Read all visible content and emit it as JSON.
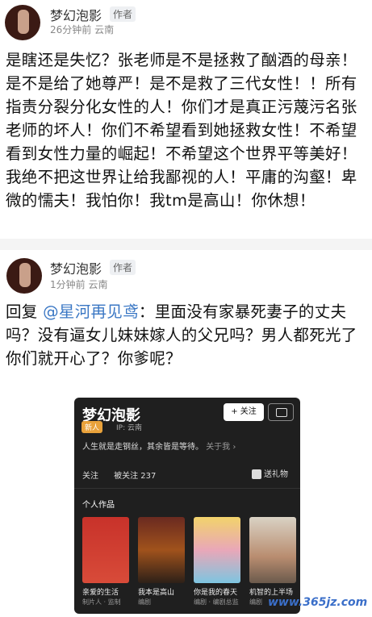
{
  "post1": {
    "username": "梦幻泡影",
    "role_tag": "作者",
    "time": "26分钟前",
    "location": "云南",
    "text": "是瞎还是失忆？张老师是不是拯救了酗酒的母亲！是不是给了她尊严！是不是救了三代女性！！所有指责分裂分化女性的人！你们才是真正污蔑污名张老师的坏人！你们不希望看到她拯救女性！不希望看到女性力量的崛起！不希望这个世界平等美好！我绝不把这世界让给我鄙视的人！平庸的沟壑！卑微的懦夫！我怕你！我tm是高山！你休想！"
  },
  "post2": {
    "username": "梦幻泡影",
    "role_tag": "作者",
    "time": "1分钟前",
    "location": "云南",
    "reply_prefix": "回复",
    "reply_target": "@星河再见鸢",
    "text": "：里面没有家暴死妻子的丈夫吗？没有逼女儿妹妹嫁人的父兄吗？男人都死光了你们就开心了？你爹呢？"
  },
  "profile_card": {
    "name": "梦幻泡影",
    "badge": "新人",
    "ip": "IP: 云南",
    "follow_label": "+ 关注",
    "bio": "人生就是走钢丝，其余皆是等待。",
    "bio_more": "关于我 ›",
    "following_label": "关注",
    "followers_label": "被关注",
    "followers_count": "237",
    "gift_label": "送礼物",
    "works_title": "个人作品",
    "works": [
      {
        "title": "亲爱的生活",
        "role": "制片人 · 监制"
      },
      {
        "title": "我本是高山",
        "role": "编剧"
      },
      {
        "title": "你是我的春天",
        "role": "编剧 · 编剧总监"
      },
      {
        "title": "机智的上半场",
        "role": "编剧"
      }
    ]
  },
  "watermark": "www.365jz.com"
}
